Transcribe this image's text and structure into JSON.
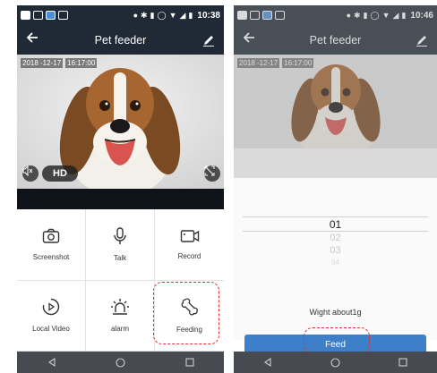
{
  "left": {
    "status": {
      "time": "10:38"
    },
    "appbar": {
      "title": "Pet feeder",
      "back_icon": "arrow-back-icon",
      "edit_icon": "pencil-icon"
    },
    "video": {
      "date": "2018 -12-17",
      "time": "16:17:00",
      "hd_label": "HD",
      "mute_icon": "speaker-mute-icon",
      "fullscreen_icon": "fullscreen-icon"
    },
    "grid": [
      {
        "label": "Screenshot",
        "icon": "camera-icon"
      },
      {
        "label": "Talk",
        "icon": "microphone-icon"
      },
      {
        "label": "Record",
        "icon": "video-camera-icon"
      },
      {
        "label": "Local Video",
        "icon": "play-circle-icon"
      },
      {
        "label": "alarm",
        "icon": "alarm-light-icon"
      },
      {
        "label": "Feeding",
        "icon": "bone-icon"
      }
    ],
    "highlight_color": "#e03030"
  },
  "right": {
    "status": {
      "time": "10:46"
    },
    "appbar": {
      "title": "Pet feeder"
    },
    "video": {
      "date": "2018 -12-17",
      "time": "16:17:00"
    },
    "picker": {
      "options": [
        "01",
        "02",
        "03",
        "04"
      ],
      "selected": "01"
    },
    "weight_label": "Wight  about1g",
    "feed_button": "Feed",
    "accent_color": "#3e7fc9"
  },
  "nav": {
    "back_icon": "nav-back-icon",
    "home_icon": "nav-home-icon",
    "recents_icon": "nav-recents-icon"
  }
}
